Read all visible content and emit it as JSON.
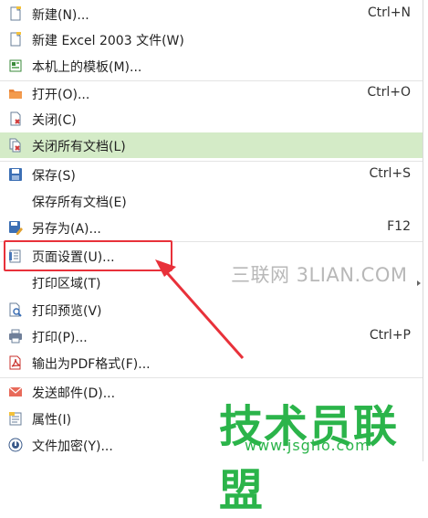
{
  "colors": {
    "highlight": "#d4ebc7",
    "accent_box": "#e8313a",
    "watermark_green": "#2bb44a",
    "watermark_gray": "#b8b8b8"
  },
  "menu": {
    "items": [
      {
        "label": "新建(N)...",
        "shortcut": "Ctrl+N",
        "icon": "new-document-icon"
      },
      {
        "label": "新建 Excel 2003 文件(W)",
        "shortcut": "",
        "icon": "new-document-icon"
      },
      {
        "label": "本机上的模板(M)...",
        "shortcut": "",
        "icon": "template-icon"
      },
      {
        "label": "打开(O)...",
        "shortcut": "Ctrl+O",
        "icon": "open-folder-icon"
      },
      {
        "label": "关闭(C)",
        "shortcut": "",
        "icon": "close-document-icon"
      },
      {
        "label": "关闭所有文档(L)",
        "shortcut": "",
        "icon": "close-all-documents-icon",
        "highlighted": true
      },
      {
        "label": "保存(S)",
        "shortcut": "Ctrl+S",
        "icon": "save-icon"
      },
      {
        "label": "保存所有文档(E)",
        "shortcut": "",
        "icon": ""
      },
      {
        "label": "另存为(A)...",
        "shortcut": "F12",
        "icon": "save-as-icon"
      },
      {
        "label": "页面设置(U)...",
        "shortcut": "",
        "icon": "page-setup-icon"
      },
      {
        "label": "打印区域(T)",
        "shortcut": "",
        "icon": ""
      },
      {
        "label": "打印预览(V)",
        "shortcut": "",
        "icon": "print-preview-icon"
      },
      {
        "label": "打印(P)...",
        "shortcut": "Ctrl+P",
        "icon": "printer-icon"
      },
      {
        "label": "输出为PDF格式(F)...",
        "shortcut": "",
        "icon": "pdf-icon"
      },
      {
        "label": "发送邮件(D)...",
        "shortcut": "",
        "icon": "mail-icon"
      },
      {
        "label": "属性(I)",
        "shortcut": "",
        "icon": "properties-icon"
      },
      {
        "label": "文件加密(Y)...",
        "shortcut": "",
        "icon": "encrypt-icon"
      }
    ]
  },
  "watermarks": {
    "site1": "三联网 3LIAN.COM",
    "site2": "技术员联盟",
    "site2_url": "www.jsgho.com"
  }
}
